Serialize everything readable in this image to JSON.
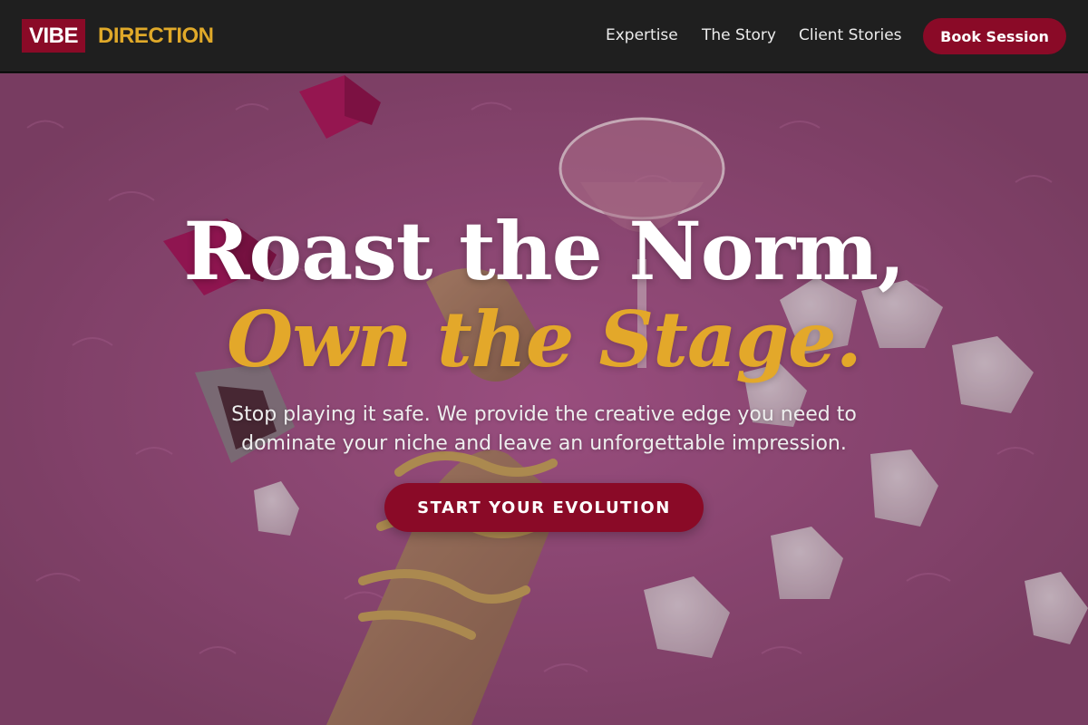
{
  "brand": {
    "vibe": "VIBE",
    "direction": "DIRECTION"
  },
  "nav": {
    "items": [
      {
        "label": "Expertise"
      },
      {
        "label": "The Story"
      },
      {
        "label": "Client Stories"
      }
    ],
    "cta_label": "Book Session"
  },
  "hero": {
    "headline_line1": "Roast the Norm,",
    "headline_line2": "Own the Stage.",
    "subtext": "Stop playing it safe. We provide the creative edge you need to dominate your niche and leave an unforgettable impression.",
    "cta_label": "START YOUR EVOLUTION"
  },
  "colors": {
    "header_bg": "#1f1f1f",
    "brand_crimson": "#8a0a27",
    "brand_gold": "#e0a929",
    "hero_pink": "#8e4a78"
  },
  "icons": {
    "hero_image": "pink-fur-cocktail-photo"
  }
}
